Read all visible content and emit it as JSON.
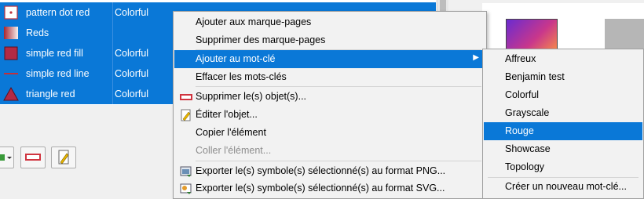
{
  "symbols": [
    {
      "name": "pattern dot  red",
      "tag": "Colorful",
      "icon": "pattern-dot-icon"
    },
    {
      "name": "Reds",
      "tag": "",
      "icon": "gradient-icon"
    },
    {
      "name": "simple red fill",
      "tag": "Colorful",
      "icon": "red-fill-icon"
    },
    {
      "name": "simple red line",
      "tag": "Colorful",
      "icon": "red-line-icon"
    },
    {
      "name": "triangle red",
      "tag": "Colorful",
      "icon": "triangle-icon"
    }
  ],
  "toolbar": {
    "add_icon": "add-symbol-icon",
    "remove_icon": "remove-icon",
    "edit_icon": "edit-pencil-icon"
  },
  "context_menu": {
    "items": [
      {
        "label": "Ajouter aux marque-pages"
      },
      {
        "label": "Supprimer des marque-pages"
      },
      {
        "label": "Ajouter au mot-clé"
      },
      {
        "label": "Effacer les mots-clés"
      },
      {
        "label": "Supprimer le(s) objet(s)..."
      },
      {
        "label": "Éditer l'objet..."
      },
      {
        "label": "Copier l'élément"
      },
      {
        "label": "Coller l'élément..."
      },
      {
        "label": "Exporter le(s) symbole(s) sélectionné(s) au format PNG..."
      },
      {
        "label": "Exporter le(s) symbole(s) sélectionné(s) au format SVG..."
      }
    ]
  },
  "submenu": {
    "items": [
      {
        "label": "Affreux"
      },
      {
        "label": "Benjamin test"
      },
      {
        "label": "Colorful"
      },
      {
        "label": "Grayscale"
      },
      {
        "label": "Rouge"
      },
      {
        "label": "Showcase"
      },
      {
        "label": "Topology"
      },
      {
        "label": "Créer un nouveau mot-clé..."
      }
    ]
  },
  "colors": {
    "selection": "#0a78d7",
    "accent_red": "#d0343f"
  }
}
